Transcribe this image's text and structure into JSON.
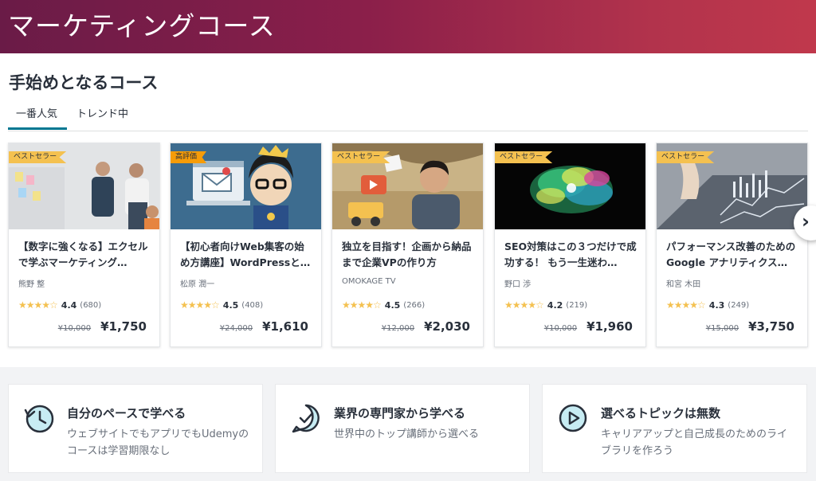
{
  "banner": {
    "title": "マーケティングコース"
  },
  "section": {
    "title": "手始めとなるコース"
  },
  "tabs": [
    {
      "label": "一番人気",
      "active": true
    },
    {
      "label": "トレンド中",
      "active": false
    }
  ],
  "courses": [
    {
      "badge": "ベストセラー",
      "title": "【数字に強くなる】エクセルで学ぶマーケティング…",
      "author": "熊野 整",
      "rating": "4.4",
      "count": "(680)",
      "old_price": "¥10,000",
      "price": "¥1,750",
      "stars": "★★★★☆"
    },
    {
      "badge": "高評価",
      "title": "【初心者向けWeb集客の始め方講座】WordPressと…",
      "author": "松原 潤一",
      "rating": "4.5",
      "count": "(408)",
      "old_price": "¥24,000",
      "price": "¥1,610",
      "stars": "★★★★☆"
    },
    {
      "badge": "ベストセラー",
      "title": "独立を目指す！企画から納品まで企業VPの作り方",
      "author": "OMOKAGE TV",
      "rating": "4.5",
      "count": "(266)",
      "old_price": "¥12,000",
      "price": "¥2,030",
      "stars": "★★★★☆"
    },
    {
      "badge": "ベストセラー",
      "title": "SEO対策はこの３つだけで成功する！ もう一生迷わ…",
      "author": "野口 渉",
      "rating": "4.2",
      "count": "(219)",
      "old_price": "¥10,000",
      "price": "¥1,960",
      "stars": "★★★★☆"
    },
    {
      "badge": "ベストセラー",
      "title": "パフォーマンス改善のためのGoogle アナリティクス…",
      "author": "和宮 木田",
      "rating": "4.3",
      "count": "(249)",
      "old_price": "¥15,000",
      "price": "¥3,750",
      "stars": "★★★★☆"
    }
  ],
  "value_props": [
    {
      "icon": "clock-rewind-icon",
      "title": "自分のペースで学べる",
      "desc": "ウェブサイトでもアプリでもUdemyのコースは学習期限なし"
    },
    {
      "icon": "check-badge-icon",
      "title": "業界の専門家から学べる",
      "desc": "世界中のトップ講師から選べる"
    },
    {
      "icon": "play-circle-icon",
      "title": "選べるトピックは無数",
      "desc": "キャリアアップと自己成長のためのライブラリを作ろう"
    }
  ],
  "colors": {
    "accent": "#007791",
    "star": "#f4c150",
    "badge": "#f4c150",
    "badge_high": "#f69c08"
  }
}
